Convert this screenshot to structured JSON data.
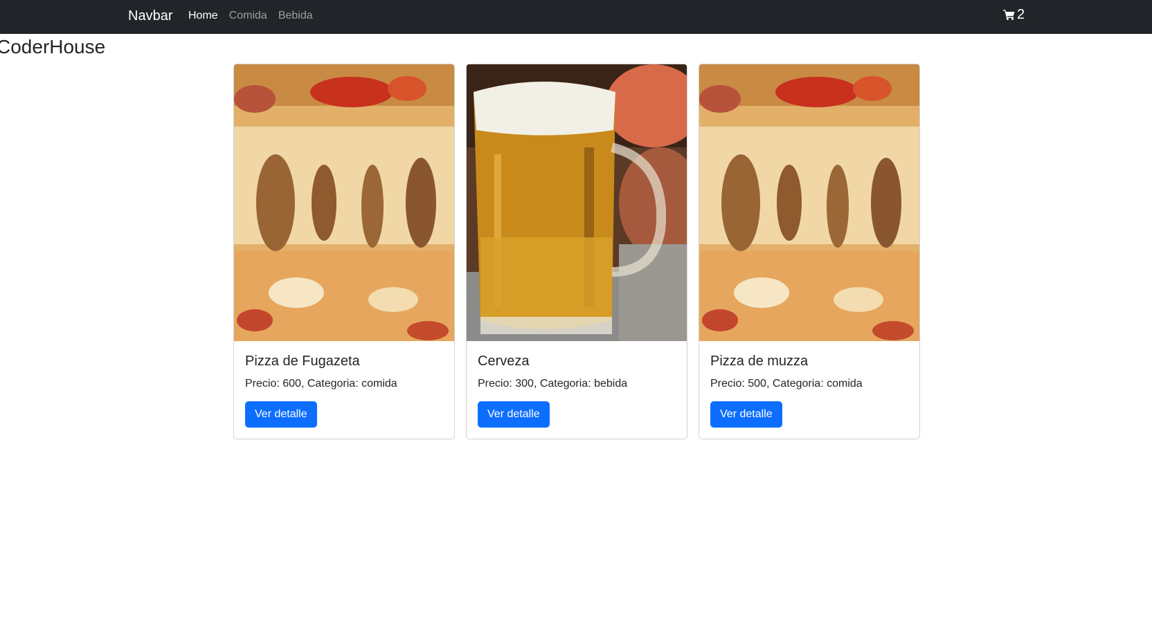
{
  "navbar": {
    "brand": "Navbar",
    "links": [
      {
        "label": "Home",
        "active": true
      },
      {
        "label": "Comida",
        "active": false
      },
      {
        "label": "Bebida",
        "active": false
      }
    ],
    "cart": {
      "icon": "cart-icon",
      "count": "2"
    }
  },
  "page": {
    "title": "CoderHouse"
  },
  "products": [
    {
      "title": "Pizza de Fugazeta",
      "details": "Precio: 600, Categoria: comida",
      "button": "Ver detalle",
      "image": "pizza-image"
    },
    {
      "title": "Cerveza",
      "details": "Precio: 300, Categoria: bebida",
      "button": "Ver detalle",
      "image": "beer-image"
    },
    {
      "title": "Pizza de muzza",
      "details": "Precio: 500, Categoria: comida",
      "button": "Ver detalle",
      "image": "pizza-image"
    }
  ],
  "colors": {
    "navbar_bg": "#212529",
    "primary_button": "#0d6efd",
    "text": "#212529"
  }
}
